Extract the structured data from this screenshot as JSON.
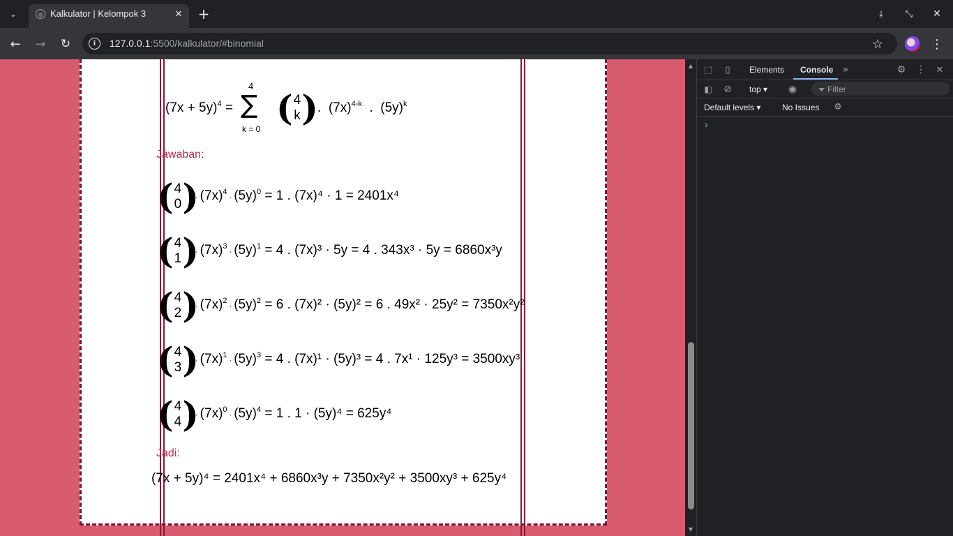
{
  "browser": {
    "tab_title": "Kalkulator | Kelompok 3",
    "url_host": "127.0.0.1",
    "url_rest": ":5500/kalkulator/#binomial",
    "icons": [
      "tab-search-icon",
      "globe-icon",
      "close-icon",
      "new-tab-icon",
      "download-icon",
      "restore-icon",
      "window-close-icon",
      "back-icon",
      "forward-icon",
      "reload-icon",
      "site-info-icon",
      "bookmark-star-icon",
      "profile-avatar-icon",
      "menu-kebab-icon"
    ]
  },
  "page": {
    "formula": {
      "lhs": "(7x + 5y)",
      "lhs_exp": "4",
      "eq": "=",
      "sum_upper": "4",
      "sum_symbol": "∑",
      "sum_lower": "k = 0",
      "binom_top": "4",
      "binom_bottom": "k",
      "dot": ".",
      "term1": "(7x)",
      "term1_exp": "4-k",
      "term2": "(5y)",
      "term2_exp": "k"
    },
    "jawaban_label": "Jawaban:",
    "rows": [
      {
        "k": "0",
        "a_exp": "4",
        "b_exp": "0",
        "result": "= 1 . (7x)⁴ · 1 = 2401x⁴"
      },
      {
        "k": "1",
        "a_exp": "3",
        "b_exp": "1",
        "result": "= 4 . (7x)³ · 5y = 4 . 343x³ · 5y = 6860x³y"
      },
      {
        "k": "2",
        "a_exp": "2",
        "b_exp": "2",
        "result": "= 6 . (7x)² · (5y)² = 6 . 49x² · 25y² = 7350x²y²"
      },
      {
        "k": "3",
        "a_exp": "1",
        "b_exp": "3",
        "result": "= 4 . (7x)¹ · (5y)³ = 4 . 7x¹ · 125y³ = 3500xy³"
      },
      {
        "k": "4",
        "a_exp": "0",
        "b_exp": "4",
        "result": "= 1 . 1 · (5y)⁴ = 625y⁴"
      }
    ],
    "jadi_label": "Jadi:",
    "final": "(7x + 5y)⁴ = 2401x⁴ + 6860x³y + 7350x²y² + 3500xy³ + 625y⁴"
  },
  "devtools": {
    "tabs": [
      "Elements",
      "Console"
    ],
    "active_tab": "Console",
    "context": "top",
    "filter_placeholder": "Filter",
    "levels": "Default levels",
    "issues": "No Issues",
    "prompt": "›"
  },
  "colors": {
    "page_bg": "#d95b70",
    "label": "#c0284a",
    "accent": "#8ab4f8"
  }
}
